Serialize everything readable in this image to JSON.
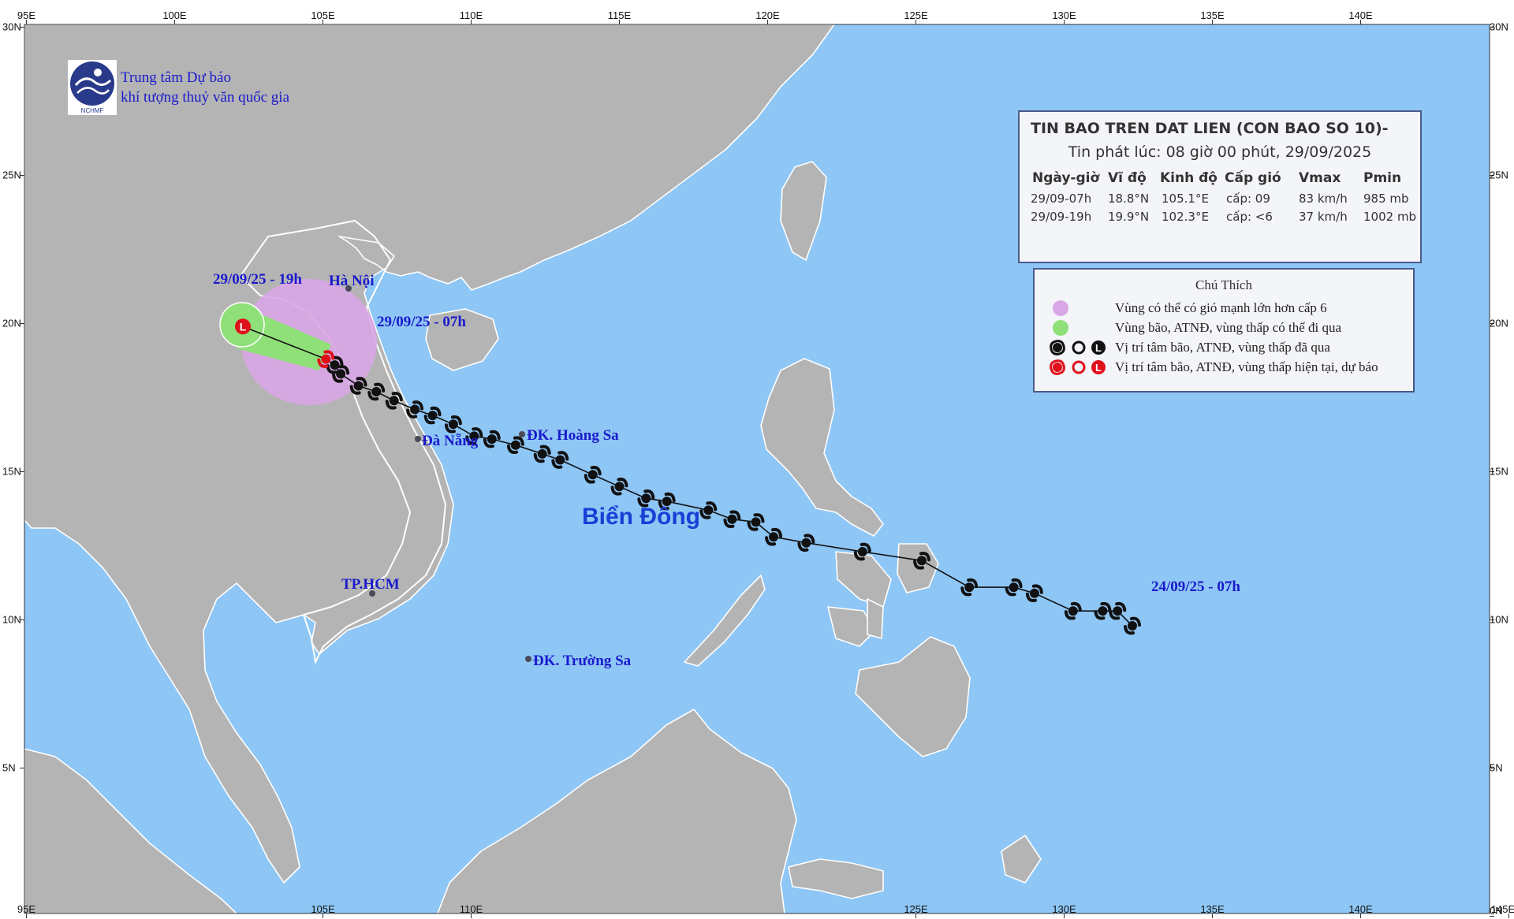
{
  "map": {
    "lon_ticks_top": [
      "95E",
      "100E",
      "105E",
      "110E",
      "115E",
      "120E",
      "125E",
      "130E",
      "135E",
      "140E"
    ],
    "lon_ticks_bottom": [
      "95E",
      "105E",
      "110E",
      "125E",
      "130E",
      "135E",
      "140E",
      "145E"
    ],
    "lat_ticks_left": [
      "30N",
      "25N",
      "20N",
      "15N",
      "10N",
      "5N"
    ],
    "lat_ticks_right": [
      "30N",
      "25N",
      "20N",
      "15N",
      "10N",
      "5N",
      "0N"
    ],
    "colors": {
      "sea": "#8ec6f5",
      "land": "#b4b4b4",
      "border": "#ffffff",
      "track": "#111111",
      "current": "#e0101a"
    }
  },
  "organization": {
    "line1": "Trung tâm Dự báo",
    "line2": "khí tượng thuỷ văn quốc gia",
    "logo_text": "NCHMF"
  },
  "places": {
    "ha_noi": "Hà Nội",
    "da_nang": "Đà Nẵng",
    "tp_hcm": "TP.HCM",
    "hoang_sa": "ĐK. Hoàng Sa",
    "truong_sa": "ĐK. Trường Sa",
    "sea_name": "Biển Đông"
  },
  "track_labels": {
    "forecast": "29/09/25 - 19h",
    "current": "29/09/25 - 07h",
    "start": "24/09/25 - 07h"
  },
  "bulletin": {
    "title": "TIN BAO TREN DAT LIEN (CON BAO SO 10)-",
    "issued": "Tin phát lúc: 08 giờ 00 phút, 29/09/2025",
    "headers": [
      "Ngày-giờ",
      "Vĩ độ",
      "Kinh độ",
      "Cấp gió",
      "Vmax",
      "Pmin"
    ],
    "rows": [
      [
        "29/09-07h",
        "18.8°N",
        "105.1°E",
        "cấp: 09",
        "83 km/h",
        "985 mb"
      ],
      [
        "29/09-19h",
        "19.9°N",
        "102.3°E",
        "cấp: <6",
        "37 km/h",
        "1002 mb"
      ]
    ]
  },
  "legend": {
    "title": "Chú Thích",
    "items": [
      "Vùng có thể có gió mạnh lớn hơn cấp 6",
      "Vùng bão, ATNĐ, vùng thấp có thể đi qua",
      "Vị trí tâm bão, ATNĐ, vùng thấp đã qua",
      "Vị trí tâm bão, ATNĐ, vùng thấp hiện tại, dự báo"
    ],
    "colors": [
      "#d9a6e6",
      "#90e07a",
      "#111111",
      "#e0101a"
    ]
  },
  "track": {
    "past_points": [
      [
        132.3,
        9.8
      ],
      [
        131.8,
        10.3
      ],
      [
        131.3,
        10.3
      ],
      [
        130.3,
        10.3
      ],
      [
        129.0,
        10.9
      ],
      [
        128.3,
        11.1
      ],
      [
        126.8,
        11.1
      ],
      [
        125.2,
        12.0
      ],
      [
        123.2,
        12.3
      ],
      [
        121.3,
        12.6
      ],
      [
        120.2,
        12.8
      ],
      [
        119.6,
        13.3
      ],
      [
        118.8,
        13.4
      ],
      [
        118.0,
        13.7
      ],
      [
        116.6,
        14.0
      ],
      [
        115.9,
        14.1
      ],
      [
        115.0,
        14.5
      ],
      [
        114.1,
        14.9
      ],
      [
        113.0,
        15.4
      ],
      [
        112.4,
        15.6
      ],
      [
        111.5,
        15.9
      ],
      [
        110.7,
        16.1
      ],
      [
        110.1,
        16.2
      ],
      [
        109.4,
        16.6
      ],
      [
        108.7,
        16.9
      ],
      [
        108.1,
        17.1
      ],
      [
        107.4,
        17.4
      ],
      [
        106.8,
        17.7
      ],
      [
        106.2,
        17.9
      ],
      [
        105.6,
        18.3
      ],
      [
        105.4,
        18.6
      ]
    ],
    "current_point": [
      105.1,
      18.8
    ],
    "forecast_point": [
      102.3,
      19.9
    ]
  }
}
